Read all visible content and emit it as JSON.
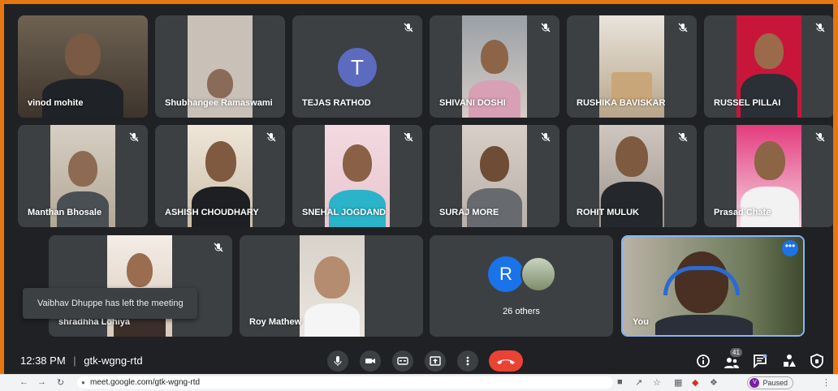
{
  "participants": [
    {
      "name": "vinod mohite",
      "muted": false
    },
    {
      "name": "Shubhangee Ramaswami",
      "muted": false
    },
    {
      "name": "TEJAS RATHOD",
      "muted": true,
      "initial": "T"
    },
    {
      "name": "SHIVANI DOSHI",
      "muted": true
    },
    {
      "name": "RUSHIKA BAVISKAR",
      "muted": true
    },
    {
      "name": "RUSSEL PILLAI",
      "muted": true
    },
    {
      "name": "Manthan Bhosale",
      "muted": true
    },
    {
      "name": "ASHISH CHOUDHARY",
      "muted": true
    },
    {
      "name": "SNEHAL JOGDAND",
      "muted": true
    },
    {
      "name": "SURAJ MORE",
      "muted": true
    },
    {
      "name": "ROHIT MULUK",
      "muted": true
    },
    {
      "name": "Prasad Chate",
      "muted": true
    },
    {
      "name": "shradhha Lohiya",
      "muted": true
    },
    {
      "name": "Roy Mathew",
      "muted": false
    },
    {
      "name": "You",
      "muted": false
    }
  ],
  "others": {
    "label": "26 others",
    "initial": "R"
  },
  "toast": "Vaibhav Dhuppe has left the meeting",
  "bottom_bar": {
    "time": "12:38 PM",
    "separator": "|",
    "meeting_code": "gtk-wgng-rtd",
    "participant_count": "41"
  },
  "browser": {
    "url": "meet.google.com/gtk-wgng-rtd",
    "profile_initial": "V",
    "status": "Paused"
  },
  "colors": {
    "frame": "#e8760f",
    "background": "#202124",
    "tile": "#3c4043",
    "end_call": "#ea4335",
    "avatar": "#5c6bc0",
    "accent": "#1a73e8"
  }
}
